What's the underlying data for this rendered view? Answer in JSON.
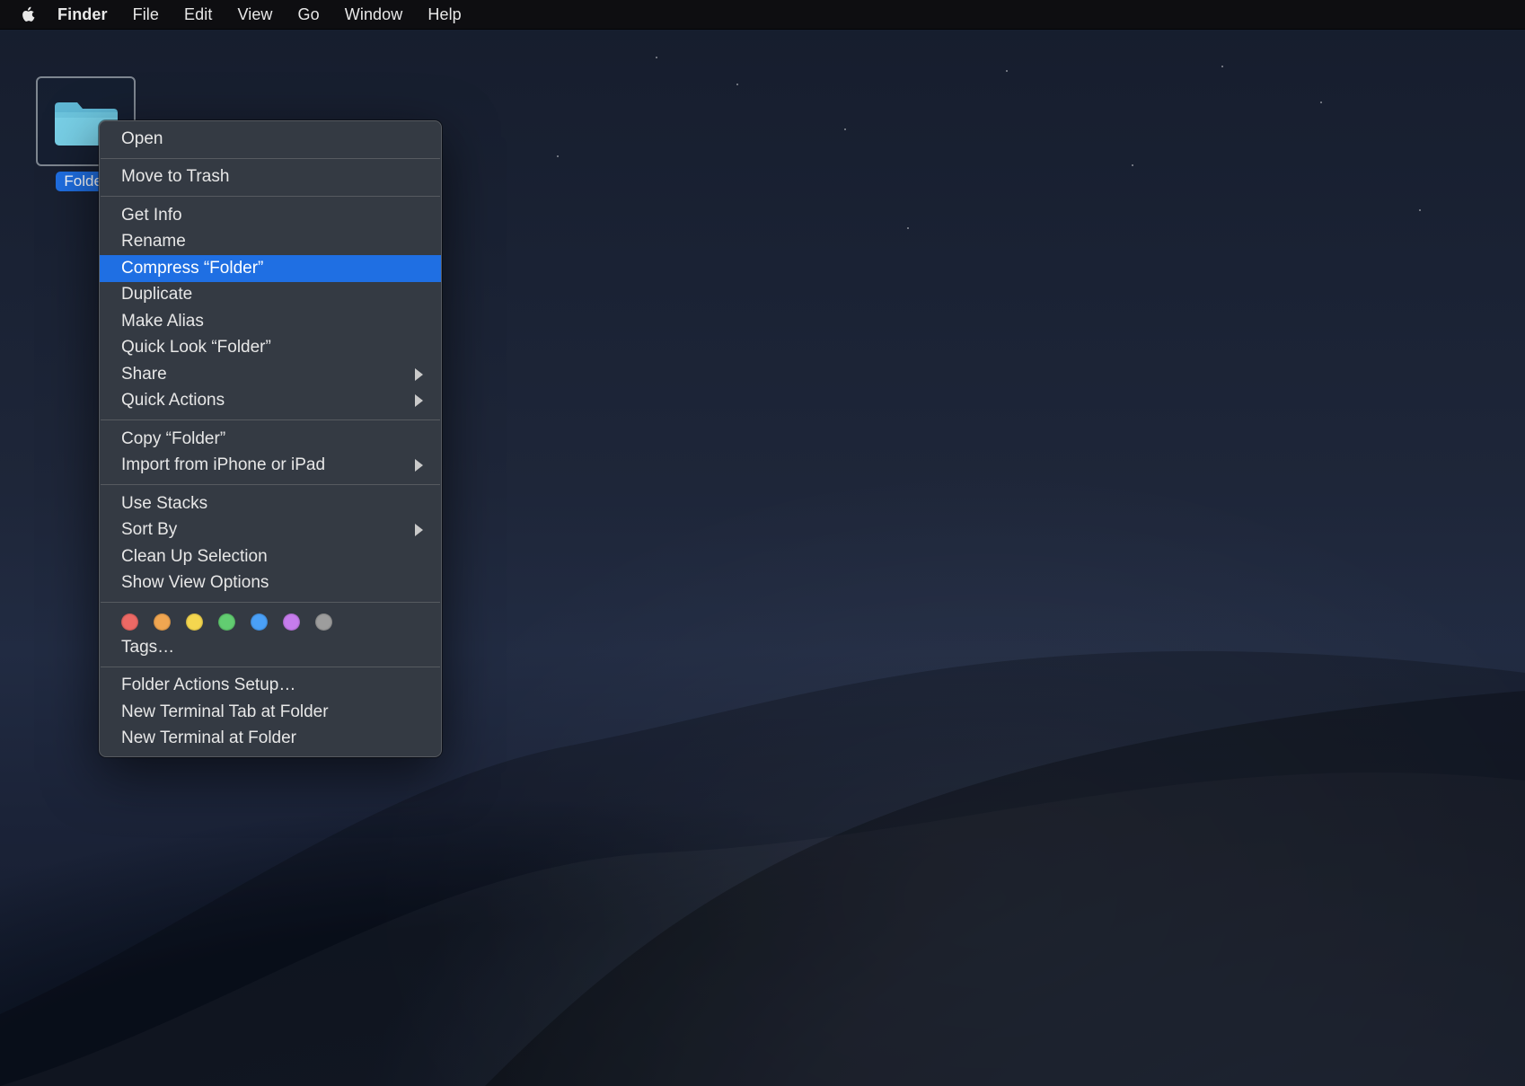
{
  "menubar": {
    "app": "Finder",
    "items": [
      "File",
      "Edit",
      "View",
      "Go",
      "Window",
      "Help"
    ]
  },
  "desktop": {
    "folder_label": "Folder"
  },
  "context_menu": {
    "groups": [
      [
        {
          "label": "Open",
          "sub": false,
          "sel": false
        }
      ],
      [
        {
          "label": "Move to Trash",
          "sub": false,
          "sel": false
        }
      ],
      [
        {
          "label": "Get Info",
          "sub": false,
          "sel": false
        },
        {
          "label": "Rename",
          "sub": false,
          "sel": false
        },
        {
          "label": "Compress “Folder”",
          "sub": false,
          "sel": true
        },
        {
          "label": "Duplicate",
          "sub": false,
          "sel": false
        },
        {
          "label": "Make Alias",
          "sub": false,
          "sel": false
        },
        {
          "label": "Quick Look “Folder”",
          "sub": false,
          "sel": false
        },
        {
          "label": "Share",
          "sub": true,
          "sel": false
        },
        {
          "label": "Quick Actions",
          "sub": true,
          "sel": false
        }
      ],
      [
        {
          "label": "Copy “Folder”",
          "sub": false,
          "sel": false
        },
        {
          "label": "Import from iPhone or iPad",
          "sub": true,
          "sel": false
        }
      ],
      [
        {
          "label": "Use Stacks",
          "sub": false,
          "sel": false
        },
        {
          "label": "Sort By",
          "sub": true,
          "sel": false
        },
        {
          "label": "Clean Up Selection",
          "sub": false,
          "sel": false
        },
        {
          "label": "Show View Options",
          "sub": false,
          "sel": false
        }
      ],
      [
        {
          "tags": [
            "#ec6965",
            "#f0a651",
            "#f4d64f",
            "#62cd71",
            "#4aa0f7",
            "#c67cec",
            "#9d9d9d"
          ]
        },
        {
          "label": "Tags…",
          "sub": false,
          "sel": false
        }
      ],
      [
        {
          "label": "Folder Actions Setup…",
          "sub": false,
          "sel": false
        },
        {
          "label": "New Terminal Tab at Folder",
          "sub": false,
          "sel": false
        },
        {
          "label": "New Terminal at Folder",
          "sub": false,
          "sel": false
        }
      ]
    ]
  }
}
